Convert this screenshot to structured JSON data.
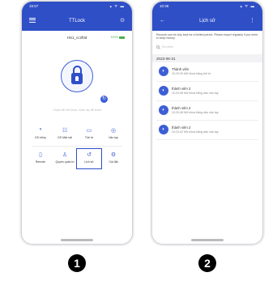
{
  "phone1": {
    "status": {
      "time": "15:57",
      "icons": "▴ ᯤ ▬"
    },
    "title": "TTLock",
    "lock_name": "HS1_cc2f0d",
    "battery_text": "100%",
    "hint": "Chạm để mở khóa, nhấn lâu để khóa",
    "grid": [
      [
        {
          "label": "DS eKey",
          "icon": "ekey-icon",
          "glyph": "ᕐ"
        },
        {
          "label": "DS Mật mã",
          "icon": "passcode-icon",
          "glyph": "☷"
        },
        {
          "label": "Thẻ từ",
          "icon": "card-icon",
          "glyph": "▭"
        },
        {
          "label": "Vân tay",
          "icon": "fingerprint-icon",
          "glyph": "◎"
        }
      ],
      [
        {
          "label": "Remote",
          "icon": "remote-icon",
          "glyph": "▯"
        },
        {
          "label": "Quyền quản trị",
          "icon": "admin-icon",
          "glyph": "♙"
        },
        {
          "label": "Lịch sử",
          "icon": "history-icon",
          "glyph": "↺"
        },
        {
          "label": "Cài đặt",
          "icon": "settings-icon",
          "glyph": "⚙"
        }
      ]
    ]
  },
  "phone2": {
    "status": {
      "time": "10:36",
      "icons": "▴ ᯤ ▬"
    },
    "title": "Lịch sử",
    "note": "Records can be only kept for a limited period. Please export regularly if you need to keep history.",
    "search_placeholder": "Tìm kiếm",
    "date": "2023-06-31",
    "records": [
      {
        "name": "Thành viên",
        "detail": "10:20:26 Mở khóa bằng thẻ từ"
      },
      {
        "name": "thành viên 2",
        "detail": "10:20:08 Mở khóa bằng dấu vân tay"
      },
      {
        "name": "thành viên 2",
        "detail": "10:20:48 Mở khóa bằng dấu vân tay"
      },
      {
        "name": "thành viên 2",
        "detail": "10:23:42 Mở khóa bằng dấu vân tay"
      }
    ]
  },
  "badges": [
    "1",
    "2"
  ]
}
